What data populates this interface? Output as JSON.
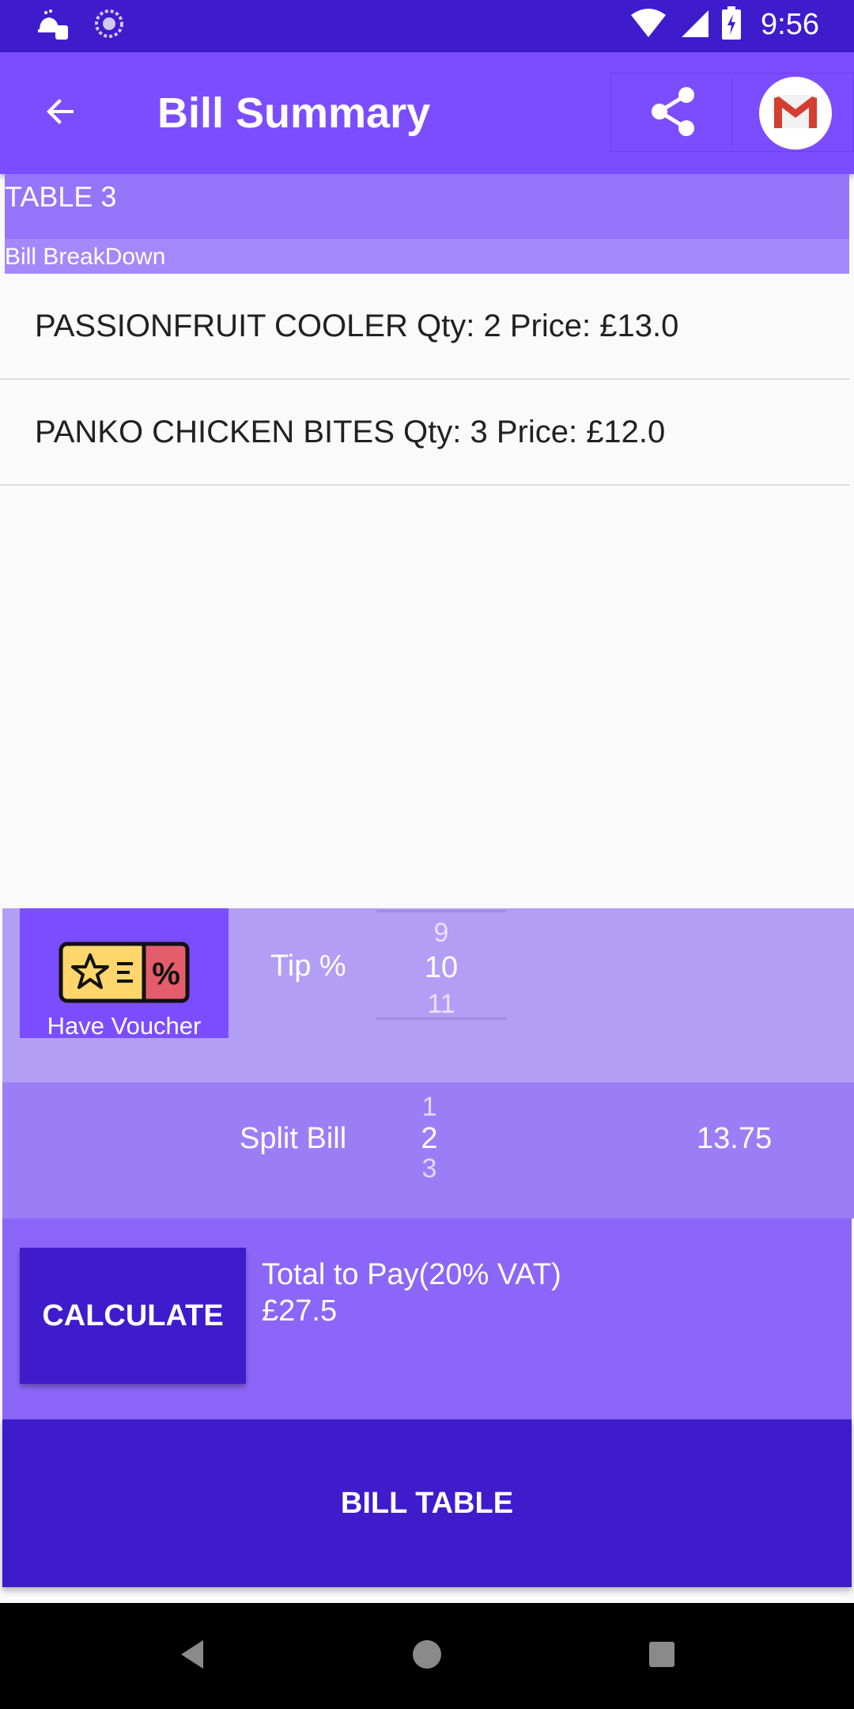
{
  "status_bar": {
    "time": "9:56"
  },
  "app_bar": {
    "title": "Bill Summary"
  },
  "table": {
    "name": "TABLE 3",
    "breakdown_label": "Bill BreakDown"
  },
  "items": [
    {
      "text": "PASSIONFRUIT COOLER  Qty:  2 Price: £13.0"
    },
    {
      "text": "PANKO CHICKEN BITES  Qty:  3 Price: £12.0"
    }
  ],
  "tip": {
    "voucher_label": "Have Voucher",
    "label": "Tip %",
    "picker": {
      "prev": "9",
      "selected": "10",
      "next": "11"
    }
  },
  "split": {
    "label": "Split Bill",
    "picker": {
      "prev": "1",
      "selected": "2",
      "next": "3"
    },
    "amount": "13.75"
  },
  "total": {
    "calculate_label": "CALCULATE",
    "label": "Total to Pay(20% VAT)",
    "value": "£27.5"
  },
  "bill_table_label": "BILL TABLE",
  "colors": {
    "primary": "#7c4dff",
    "primary_dark": "#3e1ccc",
    "tip_bg": "#b39ef5",
    "split_bg": "#9b7ef6",
    "total_bg": "#8c66f8"
  }
}
